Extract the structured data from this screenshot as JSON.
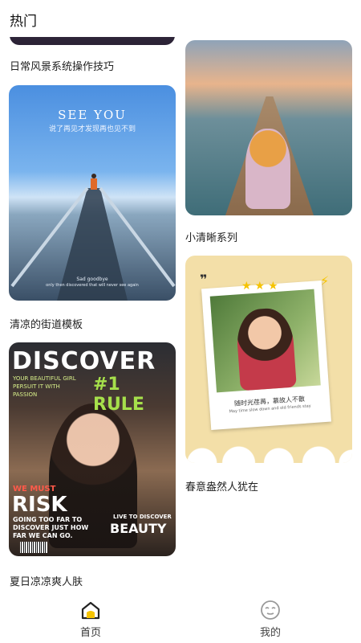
{
  "header": {
    "title": "热门"
  },
  "cards": {
    "top_left_caption": "日常风景系统操作技巧",
    "pier": {
      "caption": "清凉的街道模板",
      "headline": "SEE YOU",
      "subline": "说了再见才发现再也见不到",
      "footer1": "Sad goodbye",
      "footer2": "only then discovered that will never see again"
    },
    "discover": {
      "caption": "夏日凉凉爽人肤",
      "title": "DISCOVER",
      "rule": "#1 RULE",
      "tagline": "YOUR BEAUTIFUL GIRL PERSUIT IT WITH PASSION",
      "we_must": "WE MUST",
      "risk": "RISK",
      "risk_sub": "GOING TOO FAR TO DISCOVER JUST HOW FAR WE CAN GO.",
      "beauty_small": "LIVE TO DISCOVER",
      "beauty": "BEAUTY"
    },
    "sea": {
      "caption": "小清晰系列"
    },
    "polaroid": {
      "caption": "春意盎然人犹在",
      "text": "随时光荏苒，慕故人不散",
      "subtext": "May time slow down and old friends stay",
      "quote": "❞",
      "stars": "★★★",
      "bolt": "⚡"
    }
  },
  "bottom_nav": {
    "home_label": "首页",
    "mine_label": "我的"
  },
  "colors": {
    "home_icon_accent": "#f5c300",
    "text": "#222222",
    "background": "#ffffff"
  }
}
